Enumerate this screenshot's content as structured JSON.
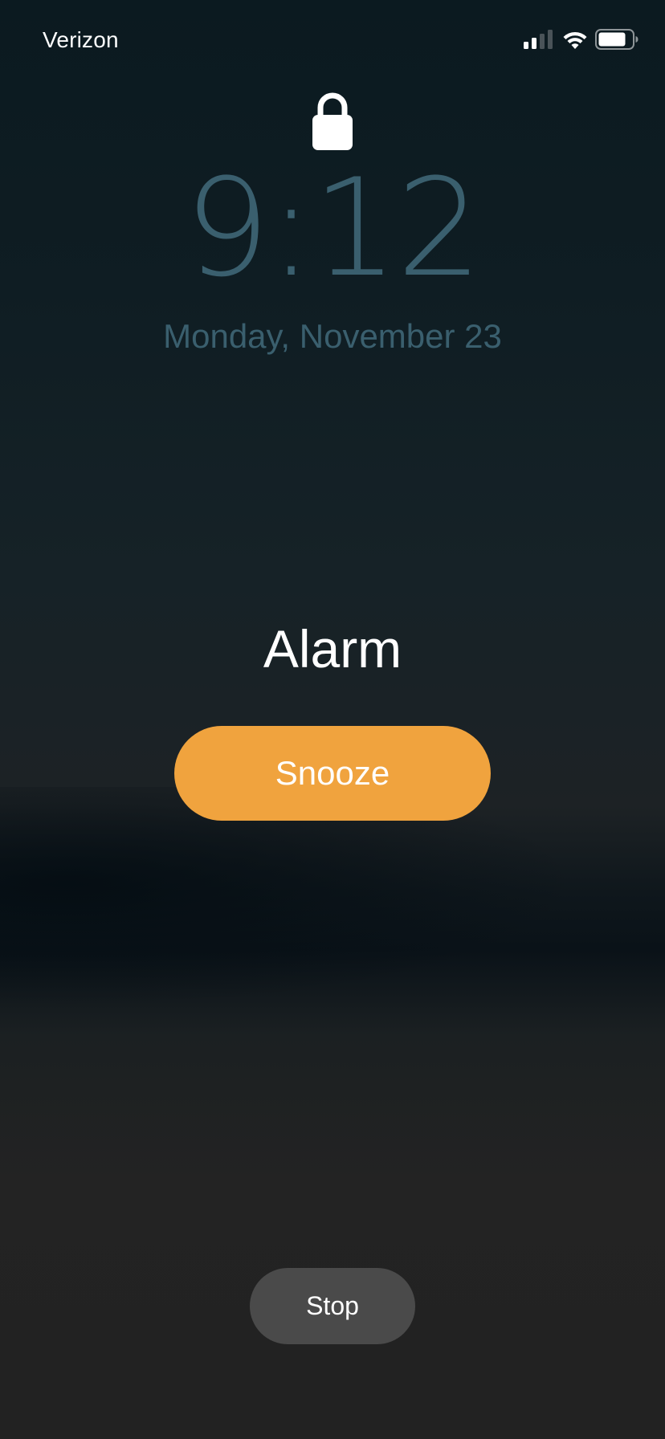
{
  "status_bar": {
    "carrier": "Verizon",
    "signal_icon": "cellular-signal-icon",
    "wifi_icon": "wifi-icon",
    "battery_icon": "battery-icon"
  },
  "lock_screen": {
    "lock_icon": "lock-icon",
    "time": "9:12",
    "date": "Monday, November 23"
  },
  "alarm": {
    "title": "Alarm",
    "snooze_label": "Snooze",
    "stop_label": "Stop"
  },
  "colors": {
    "accent_snooze": "#f0a33e",
    "stop_button": "#4a4a4a",
    "time_text": "#3a5f6e"
  }
}
